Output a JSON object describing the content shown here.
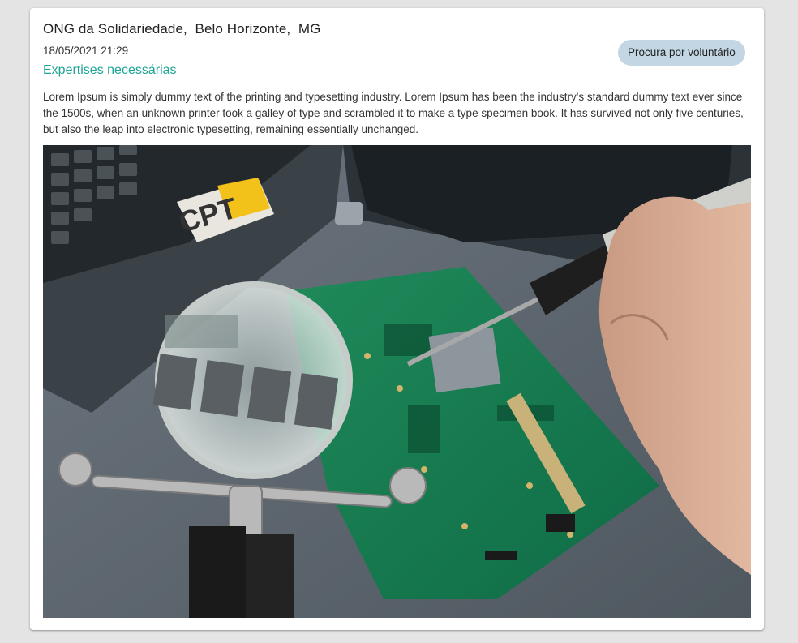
{
  "post": {
    "title": "ONG da Solidariedade,  Belo Horizonte,  MG",
    "date": "18/05/2021 21:29",
    "expertises_link": "Expertises necessárias",
    "status_badge": "Procura por voluntário",
    "description": "Lorem Ipsum is simply dummy text of the printing and typesetting industry. Lorem Ipsum has been the industry's standard dummy text ever since the 1500s, when an unknown printer took a galley of type and scrambled it to make a type specimen book. It has survived not only five centuries, but also the leap into electronic typesetting, remaining essentially unchanged.",
    "image": {
      "subject": "hand soldering a green circuit board beside a laptop and magnifying glass",
      "logo_text": "CPT"
    }
  },
  "colors": {
    "page_background": "#e4e4e4",
    "card_background": "#ffffff",
    "accent_link": "#1ea595",
    "badge_background": "#c3d6e4"
  }
}
